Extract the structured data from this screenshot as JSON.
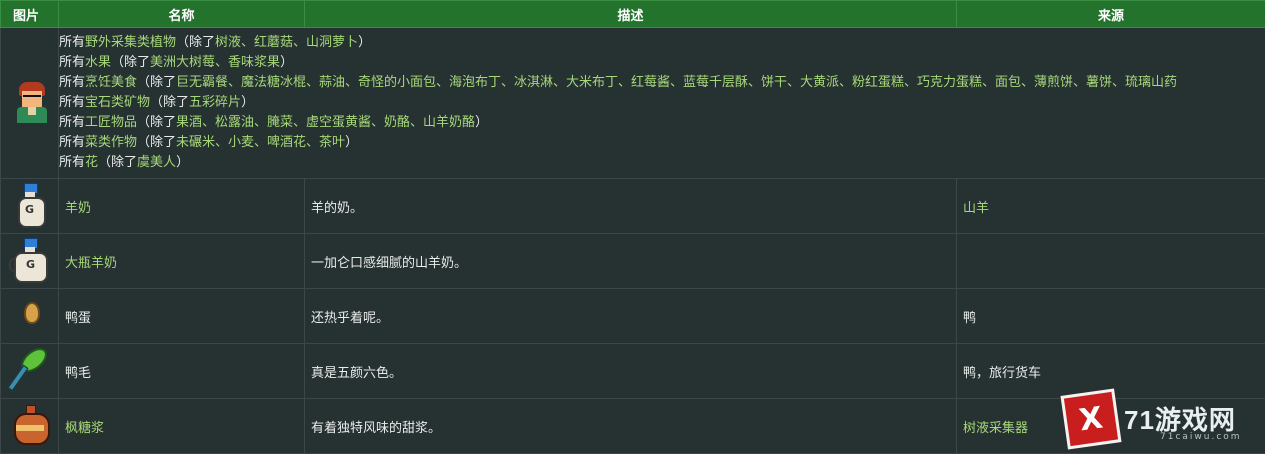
{
  "headers": {
    "image": "图片",
    "name": "名称",
    "description": "描述",
    "source": "来源"
  },
  "first_row": {
    "icon": "farmer-portrait-icon",
    "lines": [
      {
        "prefix": "所有",
        "link": "野外采集类植物",
        "mid": "（除了",
        "items": "树液、红蘑菇、山洞萝卜",
        "suffix": "）"
      },
      {
        "prefix": "所有",
        "link": "水果",
        "mid": "（除了",
        "items": "美洲大树莓、香味浆果",
        "suffix": "）"
      },
      {
        "prefix": "所有",
        "link": "烹饪美食",
        "mid": "（除了",
        "items": "巨无霸餐、魔法糖冰棍、蒜油、奇怪的小面包、海泡布丁、冰淇淋、大米布丁、红莓酱、蓝莓千层酥、饼干、大黄派、粉红蛋糕、巧克力蛋糕、面包、薄煎饼、薯饼、琉璃山药",
        "suffix": ""
      },
      {
        "prefix": "所有",
        "link": "宝石类矿物",
        "mid": "（除了",
        "items": "五彩碎片",
        "suffix": "）"
      },
      {
        "prefix": "所有",
        "link": "工匠物品",
        "mid": "（除了",
        "items": "果酒、松露油、腌菜、虚空蛋黄酱、奶酪、山羊奶酪",
        "suffix": "）"
      },
      {
        "prefix": "所有",
        "link": "菜类作物",
        "mid": "（除了",
        "items": "未碾米、小麦、啤酒花、茶叶",
        "suffix": "）"
      },
      {
        "prefix": "所有",
        "link": "花",
        "mid": "（除了",
        "items": "虞美人",
        "suffix": "）"
      }
    ]
  },
  "rows": [
    {
      "icon": "goat-milk-icon",
      "name": "羊奶",
      "description": "羊的奶。",
      "source": "山羊"
    },
    {
      "icon": "large-goat-milk-icon",
      "name": "大瓶羊奶",
      "description": "一加仑口感细腻的山羊奶。",
      "source": ""
    },
    {
      "icon": "duck-egg-icon",
      "name": "鸭蛋",
      "description": "还热乎着呢。",
      "source": "鸭"
    },
    {
      "icon": "duck-feather-icon",
      "name": "鸭毛",
      "description": "真是五颜六色。",
      "source": "鸭，旅行货车"
    },
    {
      "icon": "maple-syrup-icon",
      "name": "枫糖浆",
      "description": "有着独特风味的甜浆。",
      "source": "树液采集器"
    }
  ],
  "watermark": {
    "logo_char": "X",
    "text": "71游戏网",
    "sub": "71caiwu.com"
  }
}
